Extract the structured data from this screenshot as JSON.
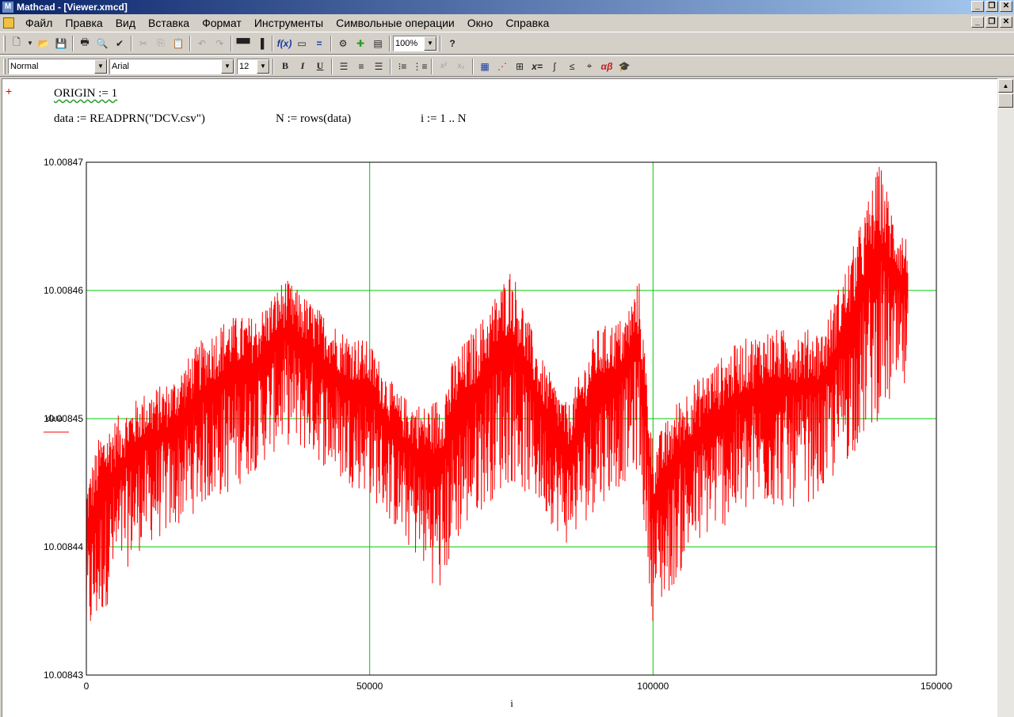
{
  "window": {
    "title": "Mathcad - [Viewer.xmcd]",
    "min_glyph": "_",
    "restore_glyph": "❐",
    "close_glyph": "✕"
  },
  "menu": [
    "Файл",
    "Правка",
    "Вид",
    "Вставка",
    "Формат",
    "Инструменты",
    "Символьные операции",
    "Окно",
    "Справка"
  ],
  "toolbar": {
    "zoom": "100%",
    "style": "Normal",
    "font": "Arial",
    "size": "12"
  },
  "worksheet": {
    "origin_line": "ORIGIN := 1",
    "data_def": "data := READPRN(\"DCV.csv\")",
    "n_def": "N := rows(data)",
    "i_def": "i := 1 .. N"
  },
  "chart_data": {
    "type": "line",
    "title": "",
    "xlabel": "i",
    "ylabel": "data",
    "xlim": [
      0,
      150000
    ],
    "ylim": [
      10.00843,
      10.00847
    ],
    "x_ticks": [
      "0",
      "50000",
      "100000",
      "150000"
    ],
    "y_ticks": [
      "10.00843",
      "10.00844",
      "10.00845",
      "10.00846",
      "10.00847"
    ],
    "grid": true,
    "grid_color": "#00cc00",
    "series": [
      {
        "color": "#ff0000",
        "x": [
          0,
          2500,
          5000,
          10000,
          15000,
          20000,
          25000,
          30000,
          35000,
          40000,
          45000,
          50000,
          55000,
          60000,
          62500,
          65000,
          70000,
          75000,
          80000,
          85000,
          90000,
          95000,
          97500,
          100000,
          105000,
          110000,
          115000,
          120000,
          125000,
          130000,
          135000,
          140000,
          142500,
          145000
        ],
        "upper": [
          10.008445,
          10.008449,
          10.00845,
          10.008452,
          10.008453,
          10.008456,
          10.008458,
          10.008458,
          10.008461,
          10.008459,
          10.008457,
          10.008456,
          10.008452,
          10.008451,
          10.008452,
          10.008455,
          10.008458,
          10.008462,
          10.008455,
          10.008451,
          10.008457,
          10.008458,
          10.008461,
          10.008448,
          10.008452,
          10.008454,
          10.008456,
          10.008457,
          10.008457,
          10.008457,
          10.008463,
          10.00847,
          10.008466,
          10.008464
        ],
        "lower": [
          10.008432,
          10.008434,
          10.008437,
          10.00844,
          10.008441,
          10.008443,
          10.008444,
          10.008446,
          10.008448,
          10.008447,
          10.008445,
          10.008444,
          10.008441,
          10.008438,
          10.008436,
          10.00844,
          10.008443,
          10.008445,
          10.008443,
          10.00844,
          10.008443,
          10.008445,
          10.008446,
          10.008434,
          10.008438,
          10.008441,
          10.008442,
          10.008443,
          10.008443,
          10.008444,
          10.008447,
          10.00845,
          10.008451,
          10.008452
        ]
      }
    ]
  }
}
